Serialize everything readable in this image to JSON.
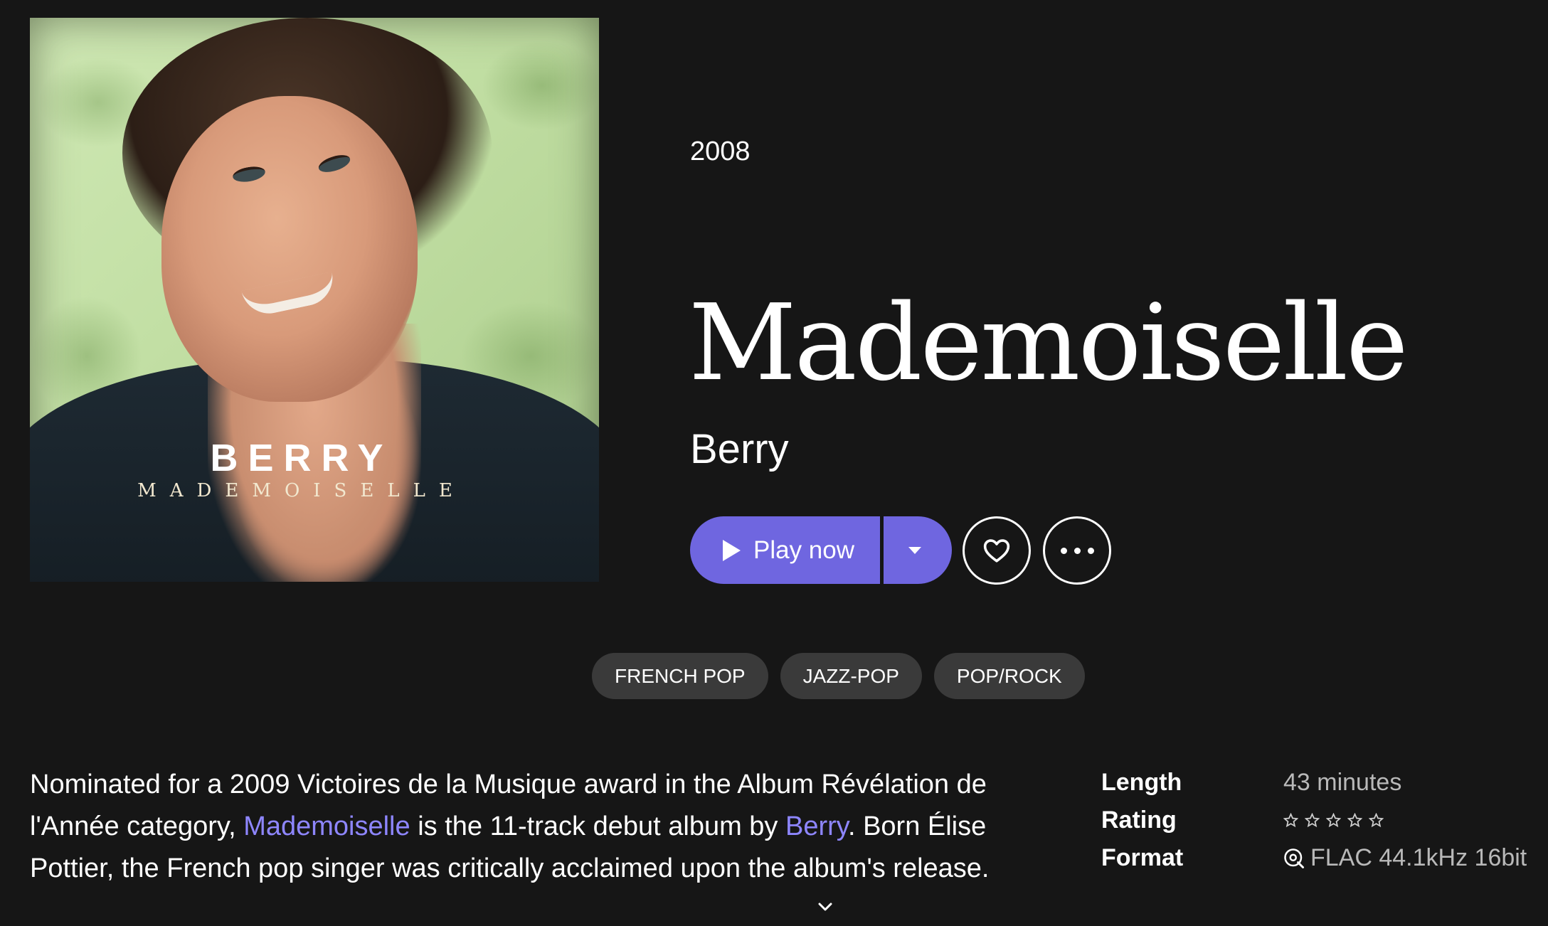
{
  "album": {
    "year": "2008",
    "title": "Mademoiselle",
    "artist": "Berry",
    "cover": {
      "artist_text": "BERRY",
      "album_text": "MADEMOISELLE"
    }
  },
  "actions": {
    "play_label": "Play now",
    "play_options_icon": "caret-down-icon",
    "favorite_icon": "heart-icon",
    "more_icon": "more-dots-icon"
  },
  "genres": [
    "FRENCH POP",
    "JAZZ-POP",
    "POP/ROCK"
  ],
  "description": {
    "part1": "Nominated for a 2009 Victoires de la Musique award in the Album Révélation de l'Année category, ",
    "link_album": "Mademoiselle",
    "part2": " is the 11-track debut album by ",
    "link_artist": "Berry",
    "part3": ". Born Élise Pottier, the French pop singer was critically acclaimed upon the album's release."
  },
  "details": {
    "length_label": "Length",
    "length_value": "43 minutes",
    "rating_label": "Rating",
    "rating_stars": 0,
    "rating_max": 5,
    "format_label": "Format",
    "format_value": "FLAC 44.1kHz 16bit"
  },
  "colors": {
    "background": "#161616",
    "accent": "#6f66e0",
    "link": "#8e86ff",
    "chip": "#3a3a3a",
    "muted_text": "#b9b9b9"
  }
}
